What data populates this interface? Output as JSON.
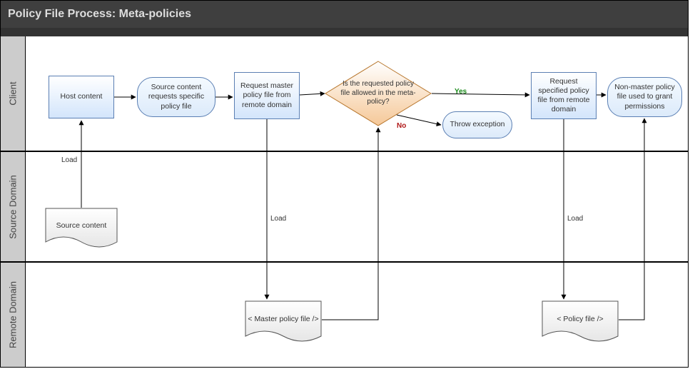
{
  "title": "Policy File Process: Meta-policies",
  "lanes": {
    "client": "Client",
    "source_domain": "Source Domain",
    "remote_domain": "Remote Domain"
  },
  "nodes": {
    "host_content": "Host content",
    "source_req_specific": "Source content requests specific policy file",
    "request_master": "Request master policy file from remote domain",
    "decision": "Is the requested policy file allowed in the meta-policy?",
    "throw_exception": "Throw exception",
    "request_specified": "Request specified policy file from remote domain",
    "nonmaster_grant": "Non-master policy file used to grant permissions",
    "source_content": "Source content",
    "master_policy_file": "< Master policy file />",
    "policy_file": "< Policy file />"
  },
  "edges": {
    "load1": "Load",
    "load2": "Load",
    "load3": "Load",
    "yes": "Yes",
    "no": "No"
  }
}
